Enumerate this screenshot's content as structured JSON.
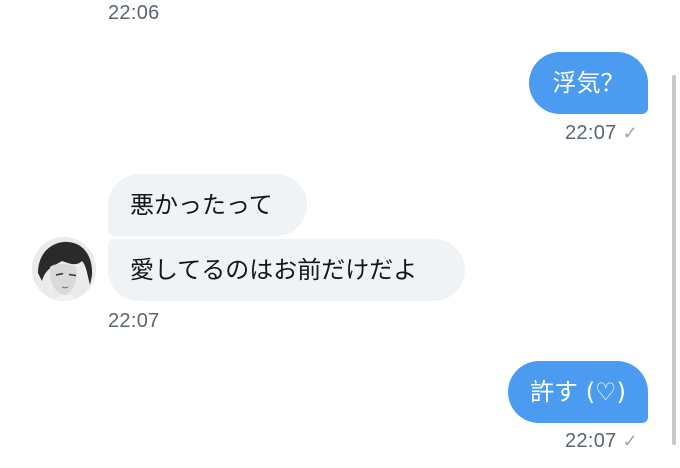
{
  "messages": [
    {
      "time": "22:06"
    },
    {
      "text": "浮気？",
      "time": "22:07",
      "status_icon": "read-check-icon"
    },
    {
      "text": "悪かったって"
    },
    {
      "text": "愛してるのはお前だけだよ",
      "time": "22:07"
    },
    {
      "text": "許す (♡)",
      "time": "22:07",
      "status_icon": "read-check-icon"
    }
  ],
  "colors": {
    "outgoing_bubble": "#4b9cf0",
    "incoming_bubble": "#eff3f5",
    "timestamp": "#5b6670"
  }
}
